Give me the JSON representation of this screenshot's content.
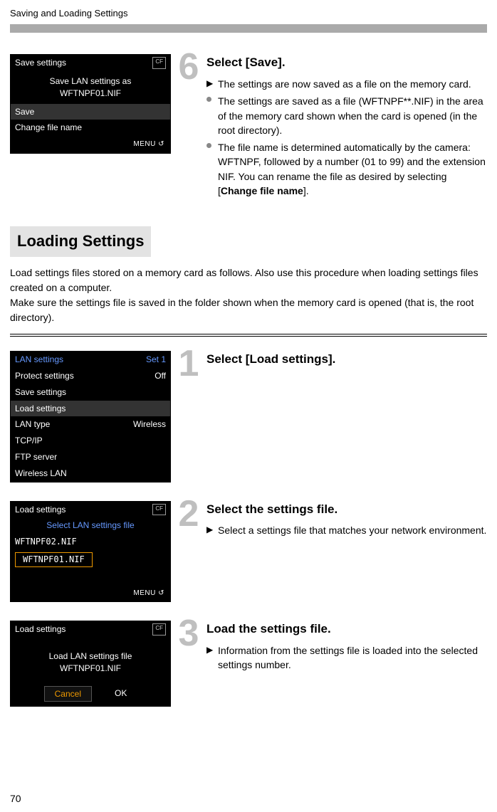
{
  "chapter_title": "Saving and Loading Settings",
  "page_number": "70",
  "step6": {
    "number": "6",
    "title": "Select [Save].",
    "lines": [
      {
        "marker": "▶",
        "text": "The settings are now saved as a file on the memory card."
      },
      {
        "marker": "●",
        "text": "The settings are saved as a file (WFTNPF**.NIF) in the area of the memory card shown when the card is opened (in the root directory)."
      },
      {
        "marker": "●",
        "text_before": "The file name is determined automatically by the camera: WFTNPF, followed by a number (01 to 99) and the extension NIF. You can rename the file as desired by selecting [",
        "bold": "Change file name",
        "text_after": "]."
      }
    ],
    "lcd": {
      "title": "Save settings",
      "line1": "Save LAN settings as",
      "line2": "WFTNPF01.NIF",
      "opt1": "Save",
      "opt2": "Change file name"
    }
  },
  "loading_heading": "Loading Settings",
  "loading_para1": "Load settings files stored on a memory card as follows. Also use this procedure when loading settings files created on a computer.",
  "loading_para2": "Make sure the settings file is saved in the folder shown when the memory card is opened (that is, the root directory).",
  "step1": {
    "number": "1",
    "title": "Select [Load settings].",
    "lcd": {
      "row1_l": "LAN settings",
      "row1_r": "Set 1",
      "row2_l": "Protect settings",
      "row2_r": "Off",
      "row3_l": "Save settings",
      "row4_l": "Load settings",
      "row5_l": "LAN type",
      "row5_r": "Wireless",
      "row6_l": "TCP/IP",
      "row7_l": "FTP server",
      "row8_l": "Wireless LAN"
    }
  },
  "step2": {
    "number": "2",
    "title": "Select the settings file.",
    "body": "Select a settings file that matches your network environment.",
    "lcd": {
      "title": "Load settings",
      "sub": "Select LAN settings file",
      "f1": "WFTNPF02.NIF",
      "f2": "WFTNPF01.NIF"
    }
  },
  "step3": {
    "number": "3",
    "title": "Load the settings file.",
    "body": "Information from the settings file is loaded into the selected settings number.",
    "lcd": {
      "title": "Load settings",
      "line1": "Load LAN settings file",
      "line2": "WFTNPF01.NIF",
      "cancel": "Cancel",
      "ok": "OK"
    }
  }
}
